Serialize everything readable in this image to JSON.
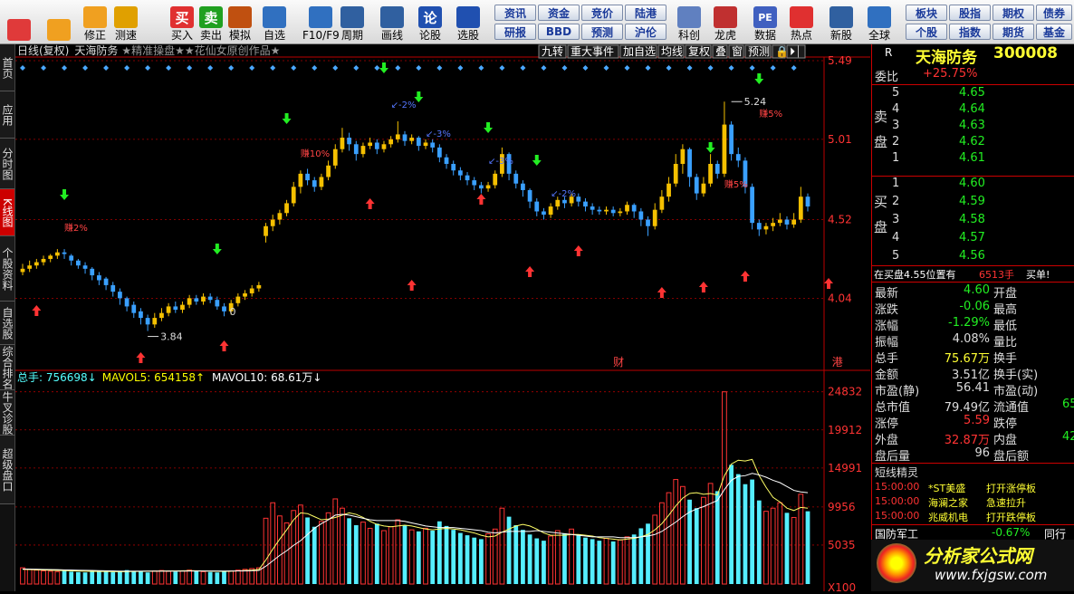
{
  "toolbar": {
    "main": [
      {
        "label": "",
        "icon": "grid-icon",
        "color": "#e03a3a"
      },
      {
        "label": "",
        "icon": "back-arrow-icon",
        "color": "#f0a020"
      },
      {
        "label": "修正",
        "icon": "up-down-arrows-icon",
        "color": "#f0a020"
      },
      {
        "label": "测速",
        "icon": "speed-clock-icon",
        "color": "#e0a000"
      },
      {
        "label": "买入",
        "icon": "buy-icon",
        "color": "#e03030",
        "glyph": "买"
      },
      {
        "label": "卖出",
        "icon": "sell-icon",
        "color": "#20a020",
        "glyph": "卖"
      },
      {
        "label": "模拟",
        "icon": "hammer-icon",
        "color": "#c05010"
      },
      {
        "label": "自选",
        "icon": "folder-icon",
        "color": "#3070c0"
      },
      {
        "label": "F10/F9",
        "icon": "document-icon",
        "color": "#3070c0"
      },
      {
        "label": "周期",
        "icon": "cycle-icon",
        "color": "#3060a0"
      },
      {
        "label": "画线",
        "icon": "pencil-icon",
        "color": "#3060a0"
      },
      {
        "label": "论股",
        "icon": "discuss-icon",
        "color": "#2050b0",
        "glyph": "论"
      },
      {
        "label": "选股",
        "icon": "stock-pick-icon",
        "color": "#2050b0"
      }
    ],
    "small": [
      "资讯",
      "资金",
      "竞价",
      "陆港",
      "研报",
      "BBD",
      "预测",
      "沪伦"
    ],
    "right": [
      {
        "label": "科创",
        "icon": "kechuang-icon",
        "color": "#6080c0"
      },
      {
        "label": "龙虎",
        "icon": "dragon-tiger-icon",
        "color": "#c03030"
      },
      {
        "label": "数据",
        "icon": "data-icon",
        "color": "#4060c0",
        "glyph": "PE"
      },
      {
        "label": "热点",
        "icon": "hot-icon",
        "color": "#e03030"
      },
      {
        "label": "新股",
        "icon": "new-stock-icon",
        "color": "#3060a0"
      },
      {
        "label": "全球",
        "icon": "globe-icon",
        "color": "#3070c0"
      }
    ],
    "small2": [
      "板块",
      "股指",
      "期权",
      "债券",
      "个股",
      "指数",
      "期货",
      "基金"
    ]
  },
  "sidebar": [
    {
      "label": "首页",
      "active": false
    },
    {
      "label": "应用",
      "active": false
    },
    {
      "label": "分时图",
      "active": false
    },
    {
      "label": "K线图",
      "active": true
    },
    {
      "label": "个股资料",
      "active": false
    },
    {
      "label": "自选股",
      "active": false
    },
    {
      "label": "综合排名",
      "active": false
    },
    {
      "label": "牛叉诊股",
      "active": false
    },
    {
      "label": "超级盘口",
      "active": false
    }
  ],
  "chart_header": {
    "title": "日线(复权)",
    "stock": "天海防务",
    "extra": "★精准操盘★★花仙女原创作品★",
    "chips": [
      "九转",
      "重大事件",
      "加自选",
      "均线",
      "复权",
      "叠",
      "窗",
      "预测",
      "🔒",
      "⏵⏐"
    ]
  },
  "chart_data": {
    "type": "candlestick",
    "price_axis_labels": [
      "5.49",
      "5.01",
      "4.52",
      "4.04"
    ],
    "price_range": [
      3.6,
      5.49
    ],
    "volume_axis_labels": [
      "24832",
      "19912",
      "14991",
      "9956",
      "5035",
      "X100"
    ],
    "volume_range": [
      0,
      25500
    ],
    "high_label": "5.24",
    "low_label": "3.84",
    "zero_label": "0",
    "volume_header": {
      "total": "总手: 756698↓",
      "mavol5": "MAVOL5: 654158↑",
      "mavol10": "MAVOL10: 68.61万↓"
    },
    "annotations": {
      "profit_1": "赚2%",
      "profit_2": "赚10%",
      "profit_3": "赚5%",
      "profit_4": "赚5%",
      "drop_1": "↙-2%",
      "drop_2": "↙-3%",
      "drop_3": "↙-3%",
      "drop_4": "↙-2%",
      "event_cai": "财",
      "event_gang": "港"
    },
    "candles": [
      [
        4.2,
        4.22,
        4.25,
        4.18
      ],
      [
        4.22,
        4.24,
        4.27,
        4.2
      ],
      [
        4.24,
        4.26,
        4.28,
        4.22
      ],
      [
        4.26,
        4.28,
        4.3,
        4.24
      ],
      [
        4.28,
        4.3,
        4.31,
        4.26
      ],
      [
        4.3,
        4.32,
        4.34,
        4.28
      ],
      [
        4.32,
        4.31,
        4.34,
        4.28
      ],
      [
        4.3,
        4.27,
        4.31,
        4.24
      ],
      [
        4.27,
        4.24,
        4.28,
        4.22
      ],
      [
        4.24,
        4.22,
        4.26,
        4.19
      ],
      [
        4.22,
        4.18,
        4.23,
        4.15
      ],
      [
        4.18,
        4.15,
        4.2,
        4.12
      ],
      [
        4.16,
        4.12,
        4.17,
        4.09
      ],
      [
        4.12,
        4.08,
        4.14,
        4.05
      ],
      [
        4.08,
        4.04,
        4.1,
        4.0
      ],
      [
        4.04,
        3.99,
        4.05,
        3.96
      ],
      [
        4.0,
        3.95,
        4.02,
        3.92
      ],
      [
        3.96,
        3.92,
        3.98,
        3.88
      ],
      [
        3.92,
        3.88,
        3.94,
        3.84
      ],
      [
        3.88,
        3.92,
        3.95,
        3.86
      ],
      [
        3.92,
        3.95,
        3.98,
        3.9
      ],
      [
        3.95,
        3.99,
        4.01,
        3.93
      ],
      [
        3.99,
        3.97,
        4.02,
        3.95
      ],
      [
        3.97,
        4.0,
        4.02,
        3.95
      ],
      [
        4.0,
        4.04,
        4.06,
        3.98
      ],
      [
        4.04,
        4.02,
        4.06,
        4.0
      ],
      [
        4.02,
        4.05,
        4.07,
        4.0
      ],
      [
        4.05,
        4.03,
        4.07,
        4.01
      ],
      [
        4.03,
        3.99,
        4.05,
        3.97
      ],
      [
        3.99,
        3.96,
        4.01,
        3.93
      ],
      [
        3.96,
        4.01,
        4.03,
        3.94
      ],
      [
        4.01,
        4.05,
        4.07,
        3.99
      ],
      [
        4.05,
        4.07,
        4.09,
        4.03
      ],
      [
        4.07,
        4.1,
        4.12,
        4.05
      ],
      [
        4.1,
        4.12,
        4.14,
        4.08
      ],
      [
        4.42,
        4.48,
        4.5,
        4.38
      ],
      [
        4.48,
        4.52,
        4.55,
        4.45
      ],
      [
        4.52,
        4.56,
        4.58,
        4.49
      ],
      [
        4.56,
        4.62,
        4.64,
        4.54
      ],
      [
        4.62,
        4.72,
        4.75,
        4.6
      ],
      [
        4.72,
        4.8,
        4.82,
        4.68
      ],
      [
        4.8,
        4.76,
        4.83,
        4.73
      ],
      [
        4.76,
        4.72,
        4.78,
        4.69
      ],
      [
        4.72,
        4.78,
        4.8,
        4.7
      ],
      [
        4.78,
        4.85,
        4.88,
        4.76
      ],
      [
        4.85,
        4.95,
        4.98,
        4.83
      ],
      [
        4.95,
        5.02,
        5.08,
        4.93
      ],
      [
        5.02,
        4.98,
        5.05,
        4.94
      ],
      [
        4.98,
        4.92,
        5.0,
        4.88
      ],
      [
        4.92,
        4.97,
        4.99,
        4.9
      ],
      [
        4.97,
        4.99,
        5.02,
        4.95
      ],
      [
        4.99,
        4.95,
        5.01,
        4.92
      ],
      [
        4.95,
        4.98,
        5.0,
        4.93
      ],
      [
        4.98,
        5.01,
        5.03,
        4.96
      ],
      [
        5.01,
        5.04,
        5.12,
        4.99
      ],
      [
        5.04,
        5.0,
        5.06,
        4.97
      ],
      [
        5.0,
        5.02,
        5.04,
        4.98
      ],
      [
        5.02,
        4.97,
        5.03,
        4.94
      ],
      [
        4.97,
        4.99,
        5.01,
        4.95
      ],
      [
        4.99,
        4.96,
        5.01,
        4.93
      ],
      [
        4.96,
        4.9,
        4.98,
        4.87
      ],
      [
        4.9,
        4.86,
        4.92,
        4.83
      ],
      [
        4.86,
        4.82,
        4.88,
        4.79
      ],
      [
        4.82,
        4.79,
        4.84,
        4.76
      ],
      [
        4.79,
        4.76,
        4.81,
        4.73
      ],
      [
        4.76,
        4.73,
        4.78,
        4.7
      ],
      [
        4.73,
        4.71,
        4.75,
        4.68
      ],
      [
        4.71,
        4.73,
        4.75,
        4.69
      ],
      [
        4.73,
        4.8,
        4.82,
        4.71
      ],
      [
        4.8,
        4.92,
        4.96,
        4.78
      ],
      [
        4.92,
        4.8,
        4.93,
        4.76
      ],
      [
        4.8,
        4.74,
        4.82,
        4.71
      ],
      [
        4.74,
        4.7,
        4.76,
        4.66
      ],
      [
        4.7,
        4.63,
        4.71,
        4.59
      ],
      [
        4.63,
        4.57,
        4.65,
        4.54
      ],
      [
        4.57,
        4.55,
        4.59,
        4.52
      ],
      [
        4.55,
        4.6,
        4.62,
        4.53
      ],
      [
        4.6,
        4.64,
        4.66,
        4.58
      ],
      [
        4.64,
        4.62,
        4.66,
        4.59
      ],
      [
        4.62,
        4.66,
        4.68,
        4.6
      ],
      [
        4.66,
        4.63,
        4.68,
        4.6
      ],
      [
        4.63,
        4.6,
        4.65,
        4.57
      ],
      [
        4.6,
        4.58,
        4.62,
        4.55
      ],
      [
        4.58,
        4.57,
        4.6,
        4.55
      ],
      [
        4.57,
        4.58,
        4.6,
        4.55
      ],
      [
        4.58,
        4.56,
        4.6,
        4.54
      ],
      [
        4.56,
        4.57,
        4.59,
        4.54
      ],
      [
        4.57,
        4.61,
        4.63,
        4.55
      ],
      [
        4.61,
        4.57,
        4.62,
        4.53
      ],
      [
        4.57,
        4.52,
        4.59,
        4.48
      ],
      [
        4.52,
        4.48,
        4.54,
        4.42
      ],
      [
        4.48,
        4.58,
        4.62,
        4.46
      ],
      [
        4.58,
        4.66,
        4.7,
        4.56
      ],
      [
        4.66,
        4.74,
        4.78,
        4.63
      ],
      [
        4.74,
        4.86,
        4.92,
        4.72
      ],
      [
        4.86,
        4.95,
        4.98,
        4.8
      ],
      [
        4.95,
        4.78,
        4.96,
        4.72
      ],
      [
        4.78,
        4.68,
        4.8,
        4.64
      ],
      [
        4.68,
        4.74,
        4.78,
        4.66
      ],
      [
        4.74,
        4.86,
        4.92,
        4.72
      ],
      [
        4.86,
        4.8,
        4.88,
        4.77
      ],
      [
        4.8,
        5.1,
        5.24,
        4.78
      ],
      [
        5.1,
        4.92,
        5.12,
        4.88
      ],
      [
        4.92,
        4.88,
        4.96,
        4.84
      ],
      [
        4.88,
        4.72,
        4.9,
        4.68
      ],
      [
        4.72,
        4.5,
        4.74,
        4.46
      ],
      [
        4.5,
        4.46,
        4.52,
        4.42
      ],
      [
        4.46,
        4.48,
        4.5,
        4.43
      ],
      [
        4.48,
        4.5,
        4.53,
        4.45
      ],
      [
        4.5,
        4.52,
        4.56,
        4.48
      ],
      [
        4.52,
        4.49,
        4.54,
        4.46
      ],
      [
        4.49,
        4.52,
        4.56,
        4.47
      ],
      [
        4.52,
        4.66,
        4.72,
        4.5
      ],
      [
        4.66,
        4.6,
        4.68,
        4.57
      ]
    ],
    "volumes": [
      2100,
      1900,
      1800,
      1700,
      1650,
      1600,
      1700,
      1600,
      1550,
      1500,
      1600,
      1700,
      1600,
      1550,
      1700,
      1800,
      1650,
      1600,
      1500,
      1700,
      1750,
      1650,
      1600,
      1700,
      1800,
      1650,
      1600,
      1550,
      1500,
      1650,
      1700,
      1800,
      1900,
      2000,
      2100,
      8500,
      10500,
      8800,
      7900,
      9500,
      10200,
      8600,
      7400,
      8100,
      9200,
      11000,
      9800,
      8500,
      7600,
      8000,
      7200,
      7800,
      6900,
      7400,
      8300,
      7600,
      7000,
      6800,
      7200,
      6900,
      8100,
      7500,
      7000,
      6600,
      6300,
      6000,
      5800,
      6500,
      7100,
      9800,
      8700,
      7600,
      7000,
      6400,
      5900,
      5600,
      6200,
      6900,
      6500,
      7100,
      6400,
      6000,
      5800,
      5600,
      5900,
      5500,
      5700,
      6100,
      6400,
      7200,
      7800,
      8900,
      10500,
      11800,
      13500,
      12600,
      10900,
      9800,
      11200,
      13000,
      12000,
      24832,
      15400,
      14200,
      12900,
      13500,
      10800,
      9400,
      9800,
      10500,
      9200,
      8600,
      11600,
      9400
    ],
    "ma5": [
      1900,
      1870,
      1840,
      1810,
      1780,
      1760,
      1740,
      1710,
      1680,
      1650,
      1640,
      1630,
      1620,
      1610,
      1600,
      1610,
      1620,
      1640,
      1660,
      1670,
      1680,
      1690,
      1700,
      1710,
      1720,
      1710,
      1690,
      1670,
      1650,
      1640,
      1660,
      1690,
      1740,
      1800,
      1880,
      3100,
      4500,
      5800,
      7000,
      8300,
      9200,
      9100,
      8700,
      8300,
      8400,
      8600,
      8900,
      9200,
      9000,
      8600,
      8100,
      7700,
      7500,
      7400,
      7500,
      7600,
      7500,
      7300,
      7100,
      7000,
      7100,
      7200,
      7100,
      7000,
      6800,
      6600,
      6300,
      6100,
      6200,
      6700,
      7100,
      7500,
      7700,
      7500,
      7100,
      6600,
      6300,
      6300,
      6300,
      6400,
      6400,
      6300,
      6200,
      6000,
      5900,
      5800,
      5700,
      5800,
      5900,
      6100,
      6400,
      7000,
      7800,
      8900,
      10100,
      11100,
      11700,
      11800,
      11600,
      11700,
      11500,
      14000,
      15500,
      16000,
      15900,
      16100,
      14000,
      12500,
      11200,
      10600,
      9800,
      9500,
      9900,
      9800
    ],
    "ma10": [
      1950,
      1930,
      1910,
      1890,
      1870,
      1850,
      1830,
      1810,
      1790,
      1770,
      1750,
      1730,
      1710,
      1690,
      1670,
      1660,
      1660,
      1660,
      1660,
      1660,
      1660,
      1660,
      1660,
      1670,
      1680,
      1680,
      1680,
      1680,
      1680,
      1680,
      1680,
      1690,
      1700,
      1720,
      1750,
      2300,
      3000,
      3700,
      4300,
      5000,
      5600,
      6400,
      7200,
      7800,
      8300,
      8900,
      9000,
      8900,
      8700,
      8500,
      8300,
      8200,
      8200,
      8200,
      8200,
      8100,
      7900,
      7700,
      7500,
      7400,
      7300,
      7300,
      7300,
      7200,
      7100,
      7000,
      6900,
      6700,
      6600,
      6700,
      6800,
      6800,
      6800,
      6800,
      6900,
      6800,
      6700,
      6600,
      6500,
      6400,
      6300,
      6200,
      6100,
      6100,
      6100,
      6100,
      6000,
      6000,
      6000,
      6100,
      6200,
      6400,
      6800,
      7400,
      8000,
      8700,
      9300,
      9700,
      10000,
      10400,
      10800,
      12200,
      13400,
      13900,
      14000,
      14300,
      14100,
      13800,
      13400,
      13100,
      12600,
      12100,
      11900,
      11800
    ]
  },
  "rpanel": {
    "code_label": "R",
    "name": "天海防务",
    "code": "300008",
    "weibi_label": "委比",
    "weibi": "+25.75%",
    "sell_label": "卖盘",
    "sell": [
      [
        "5",
        "4.65"
      ],
      [
        "4",
        "4.64"
      ],
      [
        "3",
        "4.63"
      ],
      [
        "2",
        "4.62"
      ],
      [
        "1",
        "4.61"
      ]
    ],
    "buy_label": "买盘",
    "buy": [
      [
        "1",
        "4.60"
      ],
      [
        "2",
        "4.59"
      ],
      [
        "3",
        "4.58"
      ],
      [
        "4",
        "4.57"
      ],
      [
        "5",
        "4.56"
      ]
    ],
    "notice": "在买盘4.55位置有",
    "notice_vol": "6513手",
    "notice_tag": "买单!",
    "stats": [
      [
        "最新",
        "4.60",
        "开盘",
        ""
      ],
      [
        "涨跌",
        "-0.06",
        "最高",
        ""
      ],
      [
        "涨幅",
        "-1.29%",
        "最低",
        ""
      ],
      [
        "振幅",
        "4.08%",
        "量比",
        ""
      ],
      [
        "总手",
        "75.67万",
        "换手",
        ""
      ],
      [
        "金额",
        "3.51亿",
        "换手(实)",
        ""
      ],
      [
        "市盈(静)",
        "56.41",
        "市盈(动)",
        ""
      ],
      [
        "总市值",
        "79.49亿",
        "流通值",
        "65"
      ],
      [
        "涨停",
        "5.59",
        "跌停",
        ""
      ],
      [
        "外盘",
        "32.87万",
        "内盘",
        "42"
      ],
      [
        "盘后量",
        "96",
        "盘后额",
        ""
      ]
    ],
    "short_title": "短线精灵",
    "short": [
      [
        "15:00:00",
        "*ST美盛",
        "打开涨停板"
      ],
      [
        "15:00:00",
        "海澜之家",
        "急速拉升"
      ],
      [
        "15:00:00",
        "兆威机电",
        "打开跌停板"
      ]
    ],
    "sector": "国防军工",
    "sector_pct": "-0.67%",
    "sector_more": "同行",
    "logo_text": "分析家公式网",
    "logo_url": "www.fxjgsw.com",
    "colors": {
      "up": "#ff3333",
      "down": "#22ee22",
      "bull_candle": "#f5c000",
      "bear_candle": "#3aa0ff",
      "vol_up": "#ff3333",
      "vol_down": "#55eeff"
    }
  }
}
